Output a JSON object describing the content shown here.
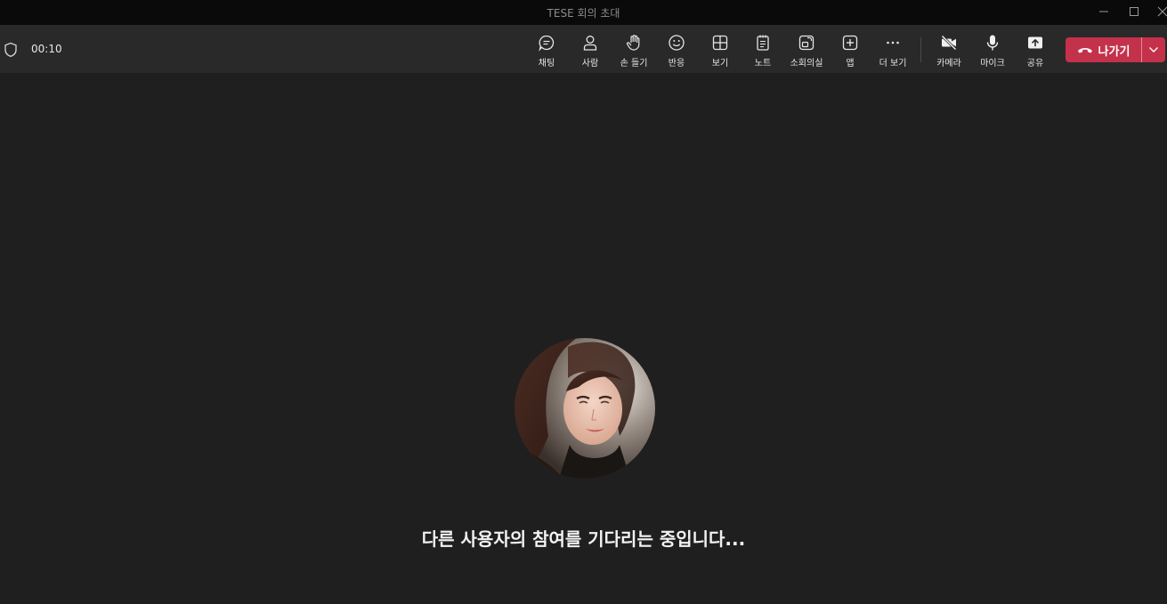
{
  "window": {
    "title": "TESE 회의 초대"
  },
  "meeting": {
    "timer": "00:10"
  },
  "toolbar": {
    "items": [
      {
        "label": "채팅",
        "icon": "chat-icon"
      },
      {
        "label": "사람",
        "icon": "people-icon"
      },
      {
        "label": "손 들기",
        "icon": "raise-hand-icon"
      },
      {
        "label": "반응",
        "icon": "reaction-icon"
      },
      {
        "label": "보기",
        "icon": "view-icon"
      },
      {
        "label": "노트",
        "icon": "notes-icon"
      },
      {
        "label": "소회의실",
        "icon": "breakout-rooms-icon"
      },
      {
        "label": "앱",
        "icon": "apps-icon"
      },
      {
        "label": "더 보기",
        "icon": "more-icon"
      },
      {
        "label": "카메라",
        "icon": "camera-off-icon"
      },
      {
        "label": "마이크",
        "icon": "mic-icon"
      },
      {
        "label": "공유",
        "icon": "share-icon"
      }
    ],
    "leave_label": "나가기"
  },
  "stage": {
    "waiting_text": "다른 사용자의 참여를 기다리는 중입니다..."
  },
  "colors": {
    "leave_button": "#c4314b",
    "toolbar_bg": "#292929",
    "stage_bg": "#1f1f1f"
  }
}
